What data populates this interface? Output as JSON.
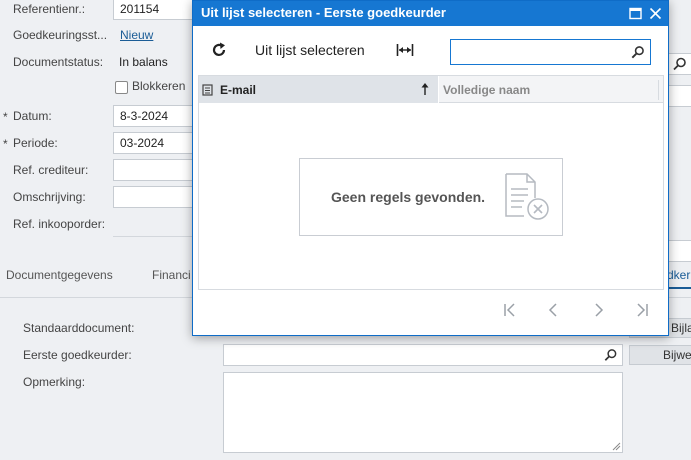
{
  "form": {
    "refnr_label": "Referentienr.:",
    "refnr_value": "201154",
    "approval_label": "Goedkeuringsst...",
    "approval_value": "Nieuw",
    "docstatus_label": "Documentstatus:",
    "docstatus_value": "In balans",
    "block_label": "Blokkeren",
    "date_label": "Datum:",
    "date_value": "8-3-2024",
    "period_label": "Periode:",
    "period_value": "03-2024",
    "creditor_label": "Ref. crediteur:",
    "description_label": "Omschrijving:",
    "po_label": "Ref. inkooporder:",
    "required_mark": "*"
  },
  "tabs": {
    "t1": "Documentgegevens",
    "t2": "Financi",
    "t3": "dker"
  },
  "lower": {
    "std_doc_label": "Standaarddocument:",
    "first_approver_label": "Eerste goedkeurder:",
    "remark_label": "Opmerking:",
    "btn_attach": "Bijla",
    "btn_edit": "Bijwe"
  },
  "modal": {
    "title": "Uit lijst selecteren - Eerste goedkeurder",
    "toolbar_label": "Uit lijst selecteren",
    "search_placeholder": "",
    "columns": [
      "E-mail",
      "Volledige naam"
    ],
    "empty_message": "Geen regels gevonden."
  },
  "icons": {
    "maximize": "maximize-icon",
    "close": "close-icon",
    "refresh": "refresh-icon",
    "fit": "fit-columns-icon",
    "search": "search-icon"
  },
  "colors": {
    "accent": "#1677d2",
    "link": "#1a5c96",
    "background": "#eef0f3"
  }
}
